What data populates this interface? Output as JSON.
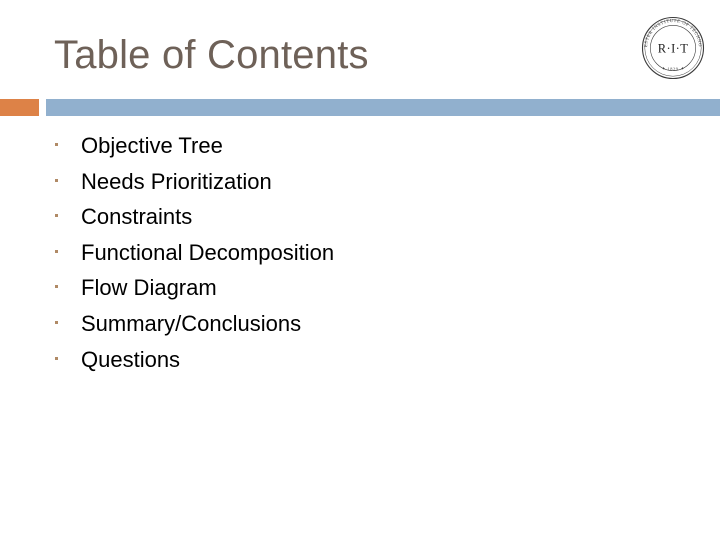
{
  "slide": {
    "title": "Table of Contents",
    "title_color": "#6e6158",
    "background_color": "#ffffff",
    "body_text_color": "#000000"
  },
  "divider": {
    "accent_color": "#dd8247",
    "bar_color": "#91b0ce"
  },
  "toc": {
    "bullet_color": "#b08a66",
    "items": [
      {
        "label": "Objective Tree"
      },
      {
        "label": "Needs Prioritization"
      },
      {
        "label": "Constraints"
      },
      {
        "label": "Functional Decomposition"
      },
      {
        "label": "Flow Diagram"
      },
      {
        "label": "Summary/Conclusions"
      },
      {
        "label": "Questions"
      }
    ]
  },
  "logo": {
    "name": "rit-seal-logo",
    "monogram": "R·I·T",
    "ring_text_top": "ROCHESTER INSTITUTE OF TECHNOLOGY",
    "year": "1829",
    "color": "#3b3b3b"
  }
}
